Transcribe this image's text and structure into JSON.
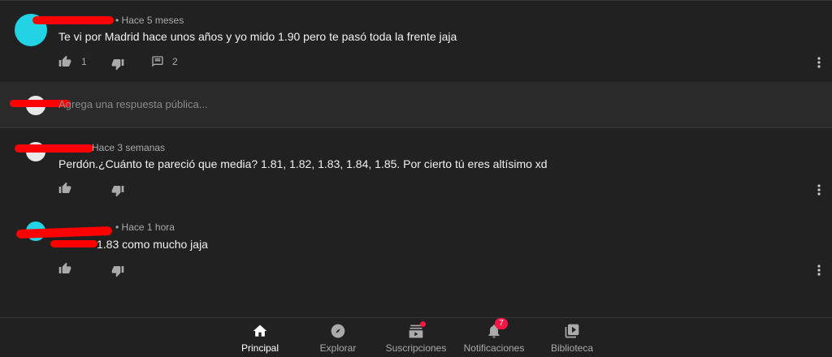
{
  "comments": [
    {
      "meta": "• Hace 5 meses",
      "text": "Te vi por Madrid hace unos años y yo mido 1.90 pero te pasó toda la frente jaja",
      "likes": "1",
      "replies": "2"
    },
    {
      "meta": "Hace 3 semanas",
      "text": "Perdón.¿Cuánto te pareció que media? 1.81, 1.82, 1.83, 1.84, 1.85. Por cierto tú eres altísimo xd"
    },
    {
      "meta": "• Hace 1 hora",
      "text": "1.83 como mucho jaja"
    }
  ],
  "reply_box": {
    "placeholder": "Agrega una respuesta pública..."
  },
  "bottom_nav": {
    "items": [
      {
        "label": "Principal",
        "icon": "home-icon"
      },
      {
        "label": "Explorar",
        "icon": "compass-icon"
      },
      {
        "label": "Suscripciones",
        "icon": "subscriptions-icon"
      },
      {
        "label": "Notificaciones",
        "icon": "bell-icon",
        "badge": "7"
      },
      {
        "label": "Biblioteca",
        "icon": "library-icon"
      }
    ]
  },
  "colors": {
    "background": "#212121",
    "accent_red": "#ff0000",
    "avatar_cyan": "#22d3e6"
  }
}
